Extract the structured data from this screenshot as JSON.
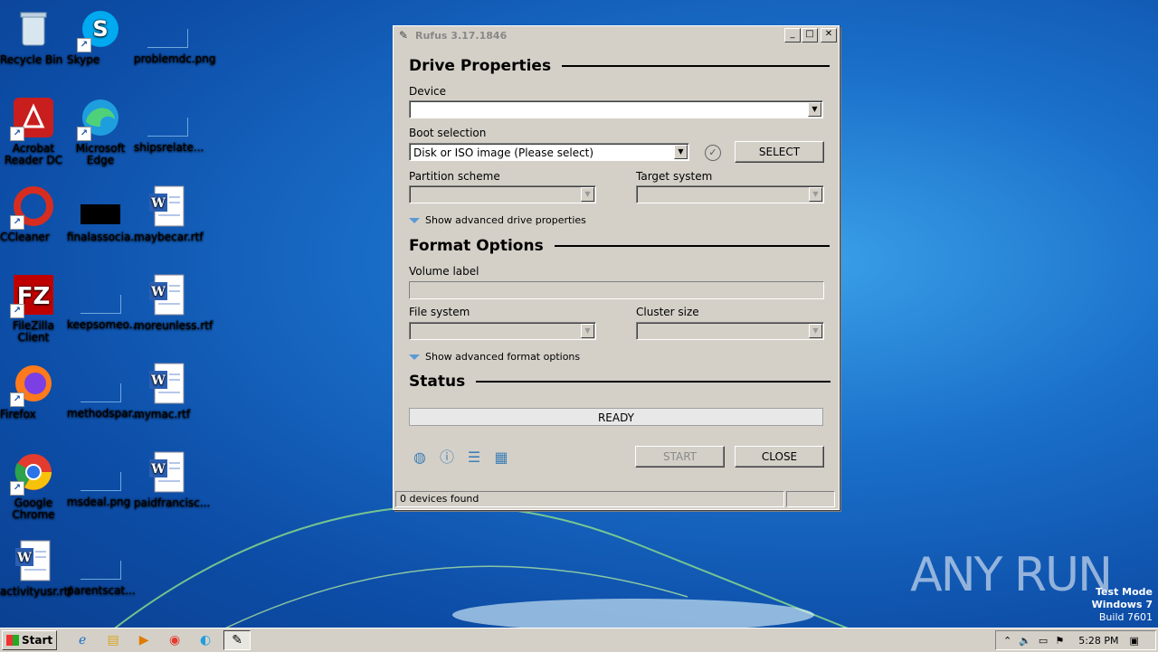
{
  "desktop": {
    "icons": [
      {
        "label": "Recycle Bin",
        "icon": "recycle-bin-icon"
      },
      {
        "label": "Skype",
        "icon": "skype-icon"
      },
      {
        "label": "problemdc.png",
        "icon": "png-file-icon"
      },
      {
        "label": "Acrobat Reader DC",
        "icon": "acrobat-icon"
      },
      {
        "label": "Microsoft Edge",
        "icon": "edge-icon"
      },
      {
        "label": "shipsrelate...",
        "icon": "file-icon"
      },
      {
        "label": "CCleaner",
        "icon": "ccleaner-icon"
      },
      {
        "label": "finalassocia...",
        "icon": "black-image-icon"
      },
      {
        "label": "maybecar.rtf",
        "icon": "rtf-file-icon"
      },
      {
        "label": "FileZilla Client",
        "icon": "filezilla-icon"
      },
      {
        "label": "keepsomeo...",
        "icon": "file-icon"
      },
      {
        "label": "moreunless.rtf",
        "icon": "rtf-file-icon"
      },
      {
        "label": "Firefox",
        "icon": "firefox-icon"
      },
      {
        "label": "methodspar...",
        "icon": "file-icon"
      },
      {
        "label": "mymac.rtf",
        "icon": "rtf-file-icon"
      },
      {
        "label": "Google Chrome",
        "icon": "chrome-icon"
      },
      {
        "label": "msdeal.png",
        "icon": "png-file-icon"
      },
      {
        "label": "paidfrancisc...",
        "icon": "rtf-file-icon"
      },
      {
        "label": "activityusr.rtf",
        "icon": "rtf-file-icon"
      },
      {
        "label": "parentscat...",
        "icon": "file-icon"
      }
    ]
  },
  "window": {
    "title": "Rufus 3.17.1846",
    "min": "_",
    "max": "□",
    "close": "✕",
    "drive_properties": "Drive Properties",
    "device_label": "Device",
    "device_value": "",
    "boot_label": "Boot selection",
    "boot_value": "Disk or ISO image (Please select)",
    "select_button": "SELECT",
    "partition_label": "Partition scheme",
    "target_label": "Target system",
    "adv_drive": "Show advanced drive properties",
    "format_options": "Format Options",
    "volume_label": "Volume label",
    "filesystem_label": "File system",
    "cluster_label": "Cluster size",
    "adv_format": "Show advanced format options",
    "status_title": "Status",
    "status_text": "READY",
    "start_button": "START",
    "close_button": "CLOSE",
    "statusbar_text": "0 devices found"
  },
  "taskbar": {
    "start": "Start",
    "time": "5:28 PM"
  },
  "watermark": "ANY RUN",
  "test_mode": {
    "line1": "Test Mode",
    "line2": "Windows 7",
    "line3": "Build 7601"
  }
}
